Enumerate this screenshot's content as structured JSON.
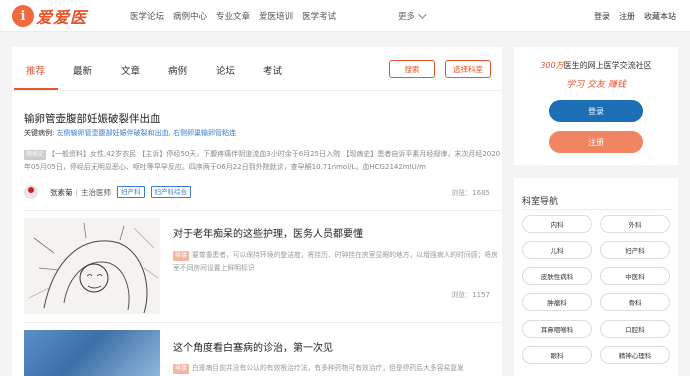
{
  "header": {
    "logo_mark": "i",
    "logo_text": "爱爱医",
    "nav": [
      "医学论坛",
      "病例中心",
      "专业文章",
      "爱医培训",
      "医学考试"
    ],
    "more_label": "更多",
    "auth": [
      "登录",
      "注册",
      "收藏本站"
    ]
  },
  "tabs": {
    "items": [
      "推荐",
      "最新",
      "文章",
      "病例",
      "论坛",
      "考试"
    ],
    "active": "推荐",
    "search_button": "搜索",
    "select_dept_button": "选择科室"
  },
  "article1": {
    "title": "输卵管壶腹部妊娠破裂伴出血",
    "kw_label": "关键病例:",
    "kw_links": "左侧输卵管壶腹部妊娠伴破裂和出血, 右侧卵巢输卵管粘连",
    "tag": "简病史",
    "body": "【一般资料】女性,42岁农民 【主诉】停经50天，下腹疼痛伴阴道流血3小时余于6月25日入院 【现病史】患者自诉平素月经规律，末次月经2020年05月05日，停经后无明显恶心、呕吐等早孕反应。四序两于06月22日到外院就诊，查孕酮10.71nmol/L，血HCG2142mIU/m",
    "author_name": "张素菊",
    "author_sep": "|",
    "author_role": "主治医师",
    "pills": [
      "妇产科",
      "妇产科综合"
    ],
    "views": "浏览：1685"
  },
  "article2": {
    "title": "对于老年痴呆的这些护理，医务人员都要懂",
    "tag": "导读",
    "summary": "要尊重患者，可以保持环境的整洁度，将挂历、时钟挂在房室显眼的地方，以增强病人的时间感；将房室不同房间设置上鲜明标识",
    "views": "浏览：1157"
  },
  "article3": {
    "title": "这个角度看白塞病的诊治，第一次见",
    "tag": "导读",
    "summary": "白塞病目前并没有公认的有效根治疗法，有多种药物可有效治疗，但是停药后大多容易复发"
  },
  "sidebar": {
    "slogan_num": "300万",
    "slogan_rest": "医生的网上医学交流社区",
    "tagline": "学习 交友 赚钱",
    "login_button": "登录",
    "register_button": "注册",
    "dept_title": "科室导航",
    "depts": [
      "内科",
      "外科",
      "儿科",
      "妇产科",
      "皮肤性病科",
      "中医科",
      "肿瘤科",
      "骨科",
      "耳鼻咽喉科",
      "口腔科",
      "眼科",
      "精神心理科"
    ]
  },
  "colors": {
    "accent": "#e8542a",
    "primary_blue": "#1c6fb5",
    "link_blue": "#3a7bd5"
  }
}
